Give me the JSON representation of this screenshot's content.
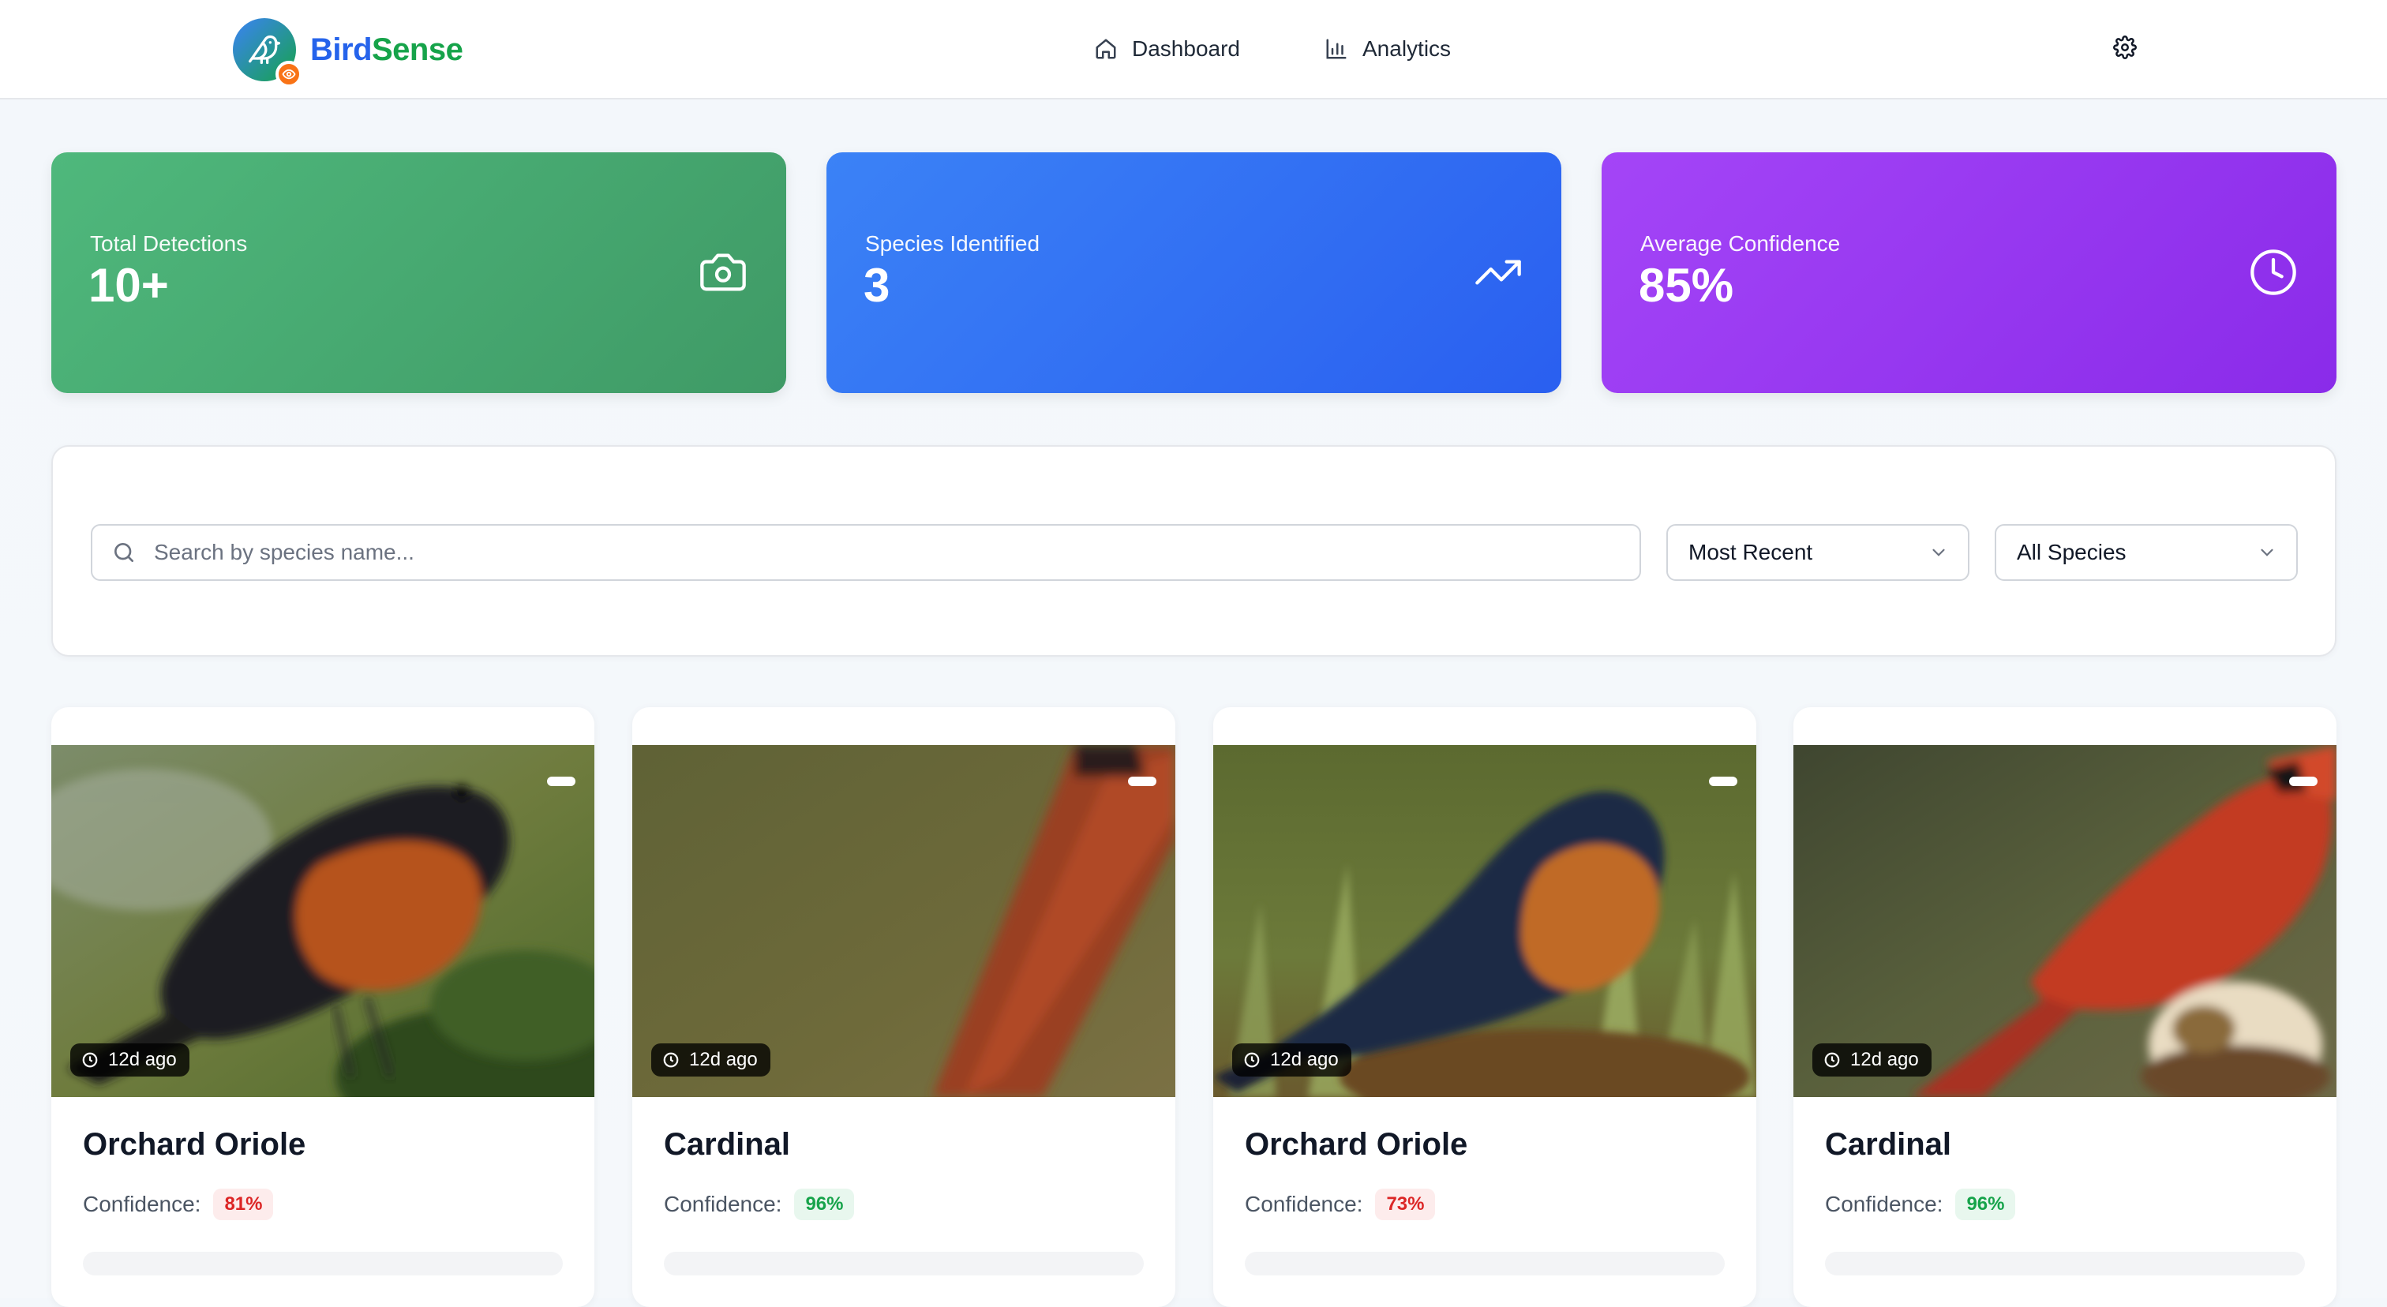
{
  "header": {
    "brand_part1": "Bird",
    "brand_part2": "Sense",
    "nav": [
      {
        "label": "Dashboard",
        "icon": "home-icon"
      },
      {
        "label": "Analytics",
        "icon": "bar-chart-icon"
      }
    ],
    "settings_icon": "gear-icon"
  },
  "stats": [
    {
      "label": "Total Detections",
      "value": "10+",
      "icon": "camera-icon",
      "color": "#4fb87c"
    },
    {
      "label": "Species Identified",
      "value": "3",
      "icon": "trending-up-icon",
      "color": "#3b82f6"
    },
    {
      "label": "Average Confidence",
      "value": "85%",
      "icon": "clock-icon",
      "color": "#a445f7"
    }
  ],
  "filters": {
    "search_placeholder": "Search by species name...",
    "sort_selected": "Most Recent",
    "species_selected": "All Species"
  },
  "cards": [
    {
      "title": "Orchard Oriole",
      "time": "12d ago",
      "confidence_label": "Confidence:",
      "confidence": "81%",
      "confidence_level": "low"
    },
    {
      "title": "Cardinal",
      "time": "12d ago",
      "confidence_label": "Confidence:",
      "confidence": "96%",
      "confidence_level": "high"
    },
    {
      "title": "Orchard Oriole",
      "time": "12d ago",
      "confidence_label": "Confidence:",
      "confidence": "73%",
      "confidence_level": "low"
    },
    {
      "title": "Cardinal",
      "time": "12d ago",
      "confidence_label": "Confidence:",
      "confidence": "96%",
      "confidence_level": "high"
    }
  ],
  "colors": {
    "brand_blue": "#2563eb",
    "brand_green": "#16a34a",
    "confidence_low": "#dc2626",
    "confidence_high": "#16a34a"
  }
}
